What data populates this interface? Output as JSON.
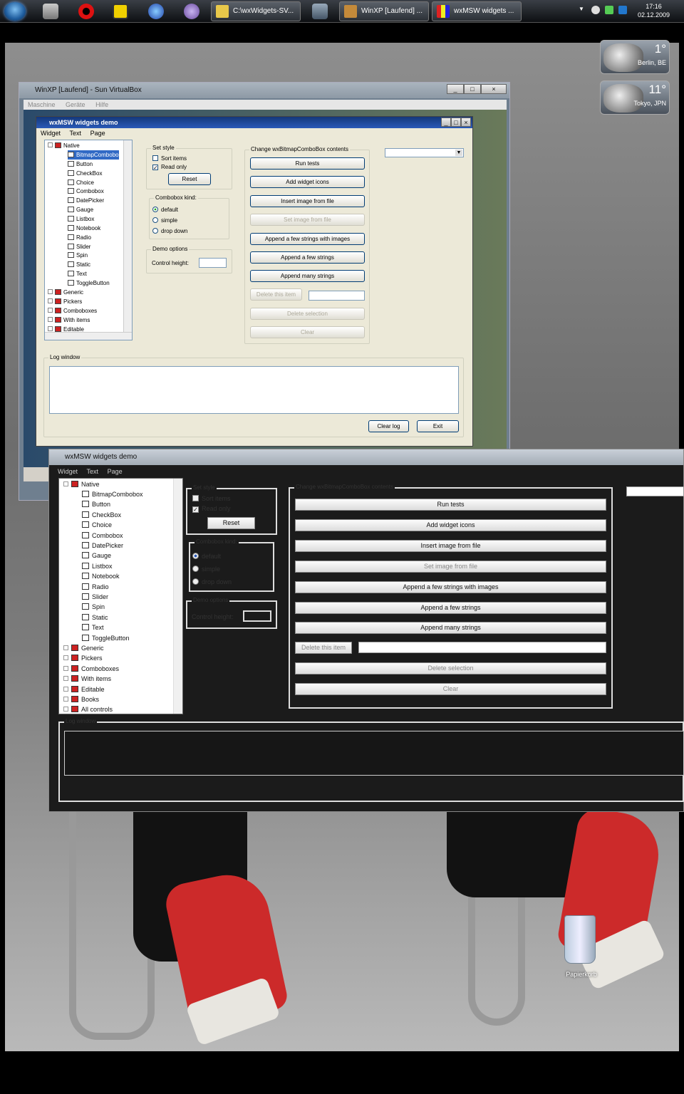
{
  "taskbar": {
    "tasks": [
      "C:\\wxWidgets-SV...",
      "WinXP [Laufend] ...",
      "wxMSW widgets ..."
    ],
    "clock_time": "17:16",
    "clock_date": "02.12.2009"
  },
  "gadgets": [
    {
      "temp": "1°",
      "city": "Berlin, BE"
    },
    {
      "temp": "11°",
      "city": "Tokyo, JPN"
    }
  ],
  "vbox": {
    "title": "WinXP [Laufend] - Sun VirtualBox",
    "menu": [
      "Maschine",
      "Geräte",
      "Hilfe"
    ]
  },
  "xp": {
    "title": "wxMSW widgets demo",
    "menu": [
      "Widget",
      "Text",
      "Page"
    ],
    "tree": {
      "root": "Native",
      "children": [
        "BitmapCombobo",
        "Button",
        "CheckBox",
        "Choice",
        "Combobox",
        "DatePicker",
        "Gauge",
        "Listbox",
        "Notebook",
        "Radio",
        "Slider",
        "Spin",
        "Static",
        "Text",
        "ToggleButton"
      ],
      "groups": [
        "Generic",
        "Pickers",
        "Comboboxes",
        "With items",
        "Editable"
      ]
    },
    "set_style": {
      "label": "Set style",
      "sort": "Sort items",
      "readonly": "Read only",
      "reset": "Reset"
    },
    "combo_kind": {
      "label": "Combobox kind:",
      "options": [
        "default",
        "simple",
        "drop down"
      ]
    },
    "demo": {
      "label": "Demo options",
      "height": "Control height:"
    },
    "change": {
      "label": "Change wxBitmapComboBox contents",
      "buttons": [
        "Run tests",
        "Add widget icons",
        "Insert image from file",
        "Set image from file",
        "Append a few strings with images",
        "Append a few strings",
        "Append many strings",
        "Delete this item",
        "Delete selection",
        "Clear"
      ]
    },
    "log": {
      "label": "Log window",
      "clear": "Clear log",
      "exit": "Exit"
    }
  },
  "dark": {
    "title": "wxMSW widgets demo",
    "menu": [
      "Widget",
      "Text",
      "Page"
    ],
    "tree": {
      "root": "Native",
      "children": [
        "BitmapCombobox",
        "Button",
        "CheckBox",
        "Choice",
        "Combobox",
        "DatePicker",
        "Gauge",
        "Listbox",
        "Notebook",
        "Radio",
        "Slider",
        "Spin",
        "Static",
        "Text",
        "ToggleButton"
      ],
      "groups": [
        "Generic",
        "Pickers",
        "Comboboxes",
        "With items",
        "Editable",
        "Books",
        "All controls"
      ]
    },
    "set_style": {
      "label": "Set style",
      "sort": "Sort items",
      "readonly": "Read only",
      "reset": "Reset"
    },
    "combo_kind": {
      "label": "Combobox kind:",
      "options": [
        "default",
        "simple",
        "drop down"
      ]
    },
    "demo": {
      "label": "Demo options",
      "height": "Control height:"
    },
    "change": {
      "label": "Change wxBitmapComboBox contents",
      "buttons": [
        "Run tests",
        "Add widget icons",
        "Insert image from file",
        "Set image from file",
        "Append a few strings with images",
        "Append a few strings",
        "Append many strings",
        "Delete this item",
        "Delete selection",
        "Clear"
      ]
    },
    "log": {
      "label": "Log window"
    }
  },
  "desktop": {
    "recycle_bin": "Papierkorb"
  }
}
